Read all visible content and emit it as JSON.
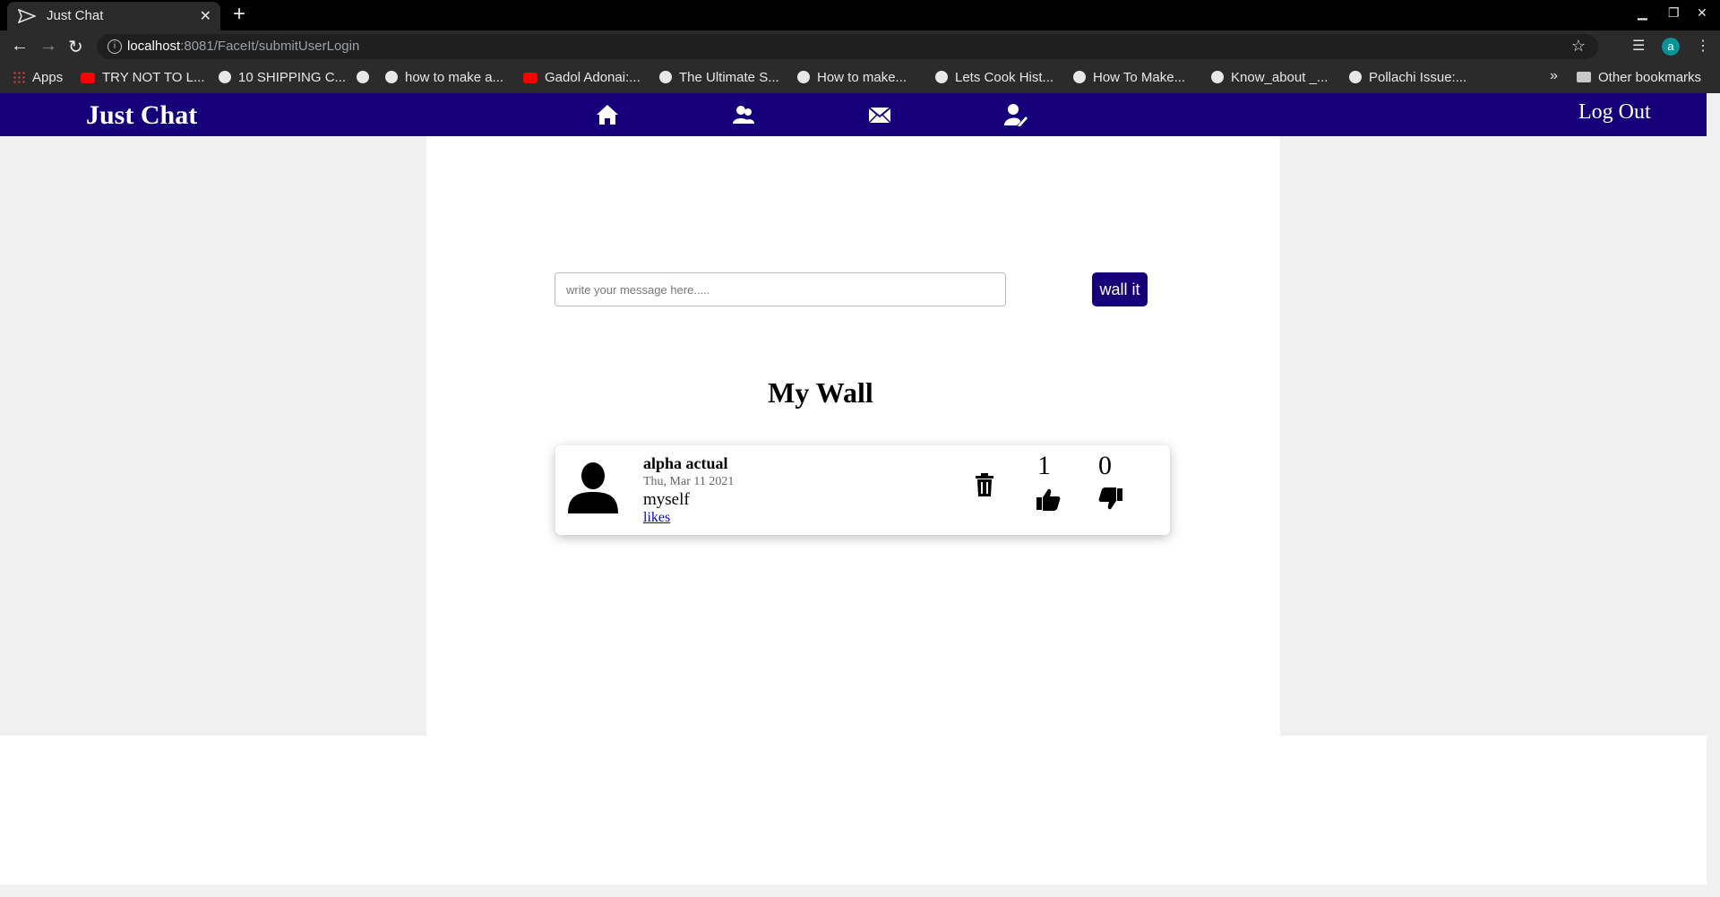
{
  "browser": {
    "tab_title": "Just Chat",
    "url_host": "localhost",
    "url_path": ":8081/FaceIt/submitUserLogin",
    "profile_initial": "a",
    "bookmarks": [
      "Apps",
      "TRY NOT TO L...",
      "10 SHIPPING C...",
      "how to make a...",
      "Gadol Adonai:...",
      "The Ultimate S...",
      "How to make...",
      "Lets Cook Hist...",
      "How To Make...",
      "Know_about _...",
      "Pollachi Issue:..."
    ],
    "other_bookmarks": "Other bookmarks"
  },
  "navbar": {
    "brand": "Just Chat",
    "icons": [
      "home-icon",
      "users-icon",
      "envelope-icon",
      "user-edit-icon"
    ],
    "logout": "Log Out",
    "color": "#15007a"
  },
  "composer": {
    "placeholder": "write your message here.....",
    "button": "wall it"
  },
  "wall": {
    "title": "My Wall",
    "posts": [
      {
        "author": "alpha actual",
        "date": "Thu, Mar 11 2021",
        "text": "myself",
        "likes_link": "likes",
        "like_count": "1",
        "dislike_count": "0"
      }
    ]
  }
}
